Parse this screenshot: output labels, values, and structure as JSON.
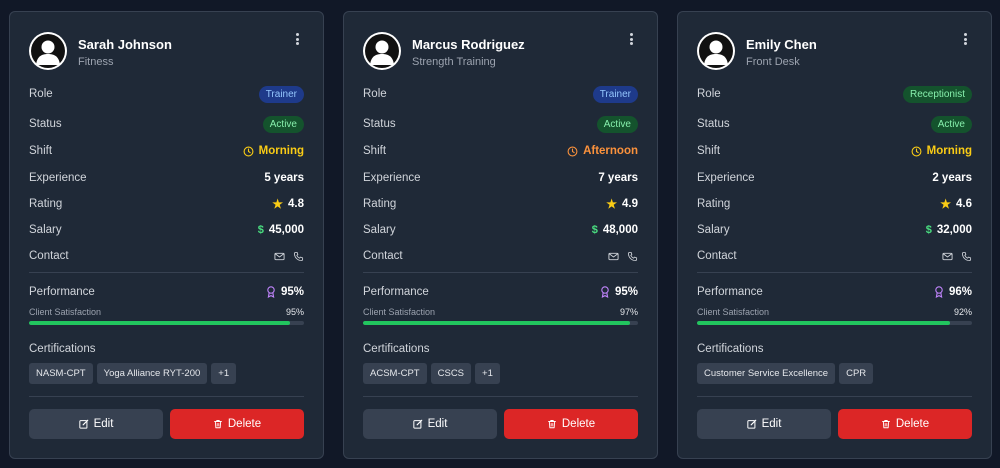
{
  "labels": {
    "role": "Role",
    "status": "Status",
    "shift": "Shift",
    "experience": "Experience",
    "rating": "Rating",
    "salary": "Salary",
    "contact": "Contact",
    "performance": "Performance",
    "satisfaction": "Client Satisfaction",
    "certifications": "Certifications",
    "edit": "Edit",
    "delete": "Delete"
  },
  "icons": {
    "menu": "more-vertical-icon",
    "shift": "clock-icon",
    "rating": "star-icon",
    "salary": "dollar-icon",
    "contact": [
      "mail-icon",
      "phone-icon"
    ],
    "performance": "award-icon",
    "edit": "edit-icon",
    "delete": "trash-icon"
  },
  "colors": {
    "card_bg": "#1f2937",
    "page_bg": "#111827",
    "trainer_badge": "#93c5fd",
    "receptionist_badge": "#86efac",
    "active_badge": "#86efac",
    "morning": "#facc15",
    "afternoon": "#fb923c",
    "progress": "#22c55e",
    "delete_button": "#dc2626"
  },
  "staff": [
    {
      "name": "Sarah Johnson",
      "department": "Fitness",
      "role": "Trainer",
      "status": "Active",
      "shift": "Morning",
      "experience": "5 years",
      "rating": "4.8",
      "salary_symbol": "$",
      "salary": "45,000",
      "performance": "95%",
      "satisfaction": "95%",
      "satisfaction_value": 0.95,
      "certifications": [
        "NASM-CPT",
        "Yoga Alliance RYT-200",
        "+1"
      ]
    },
    {
      "name": "Marcus Rodriguez",
      "department": "Strength Training",
      "role": "Trainer",
      "status": "Active",
      "shift": "Afternoon",
      "experience": "7 years",
      "rating": "4.9",
      "salary_symbol": "$",
      "salary": "48,000",
      "performance": "95%",
      "satisfaction": "97%",
      "satisfaction_value": 0.97,
      "certifications": [
        "ACSM-CPT",
        "CSCS",
        "+1"
      ]
    },
    {
      "name": "Emily Chen",
      "department": "Front Desk",
      "role": "Receptionist",
      "status": "Active",
      "shift": "Morning",
      "experience": "2 years",
      "rating": "4.6",
      "salary_symbol": "$",
      "salary": "32,000",
      "performance": "96%",
      "satisfaction": "92%",
      "satisfaction_value": 0.92,
      "certifications": [
        "Customer Service Excellence",
        "CPR"
      ]
    }
  ]
}
